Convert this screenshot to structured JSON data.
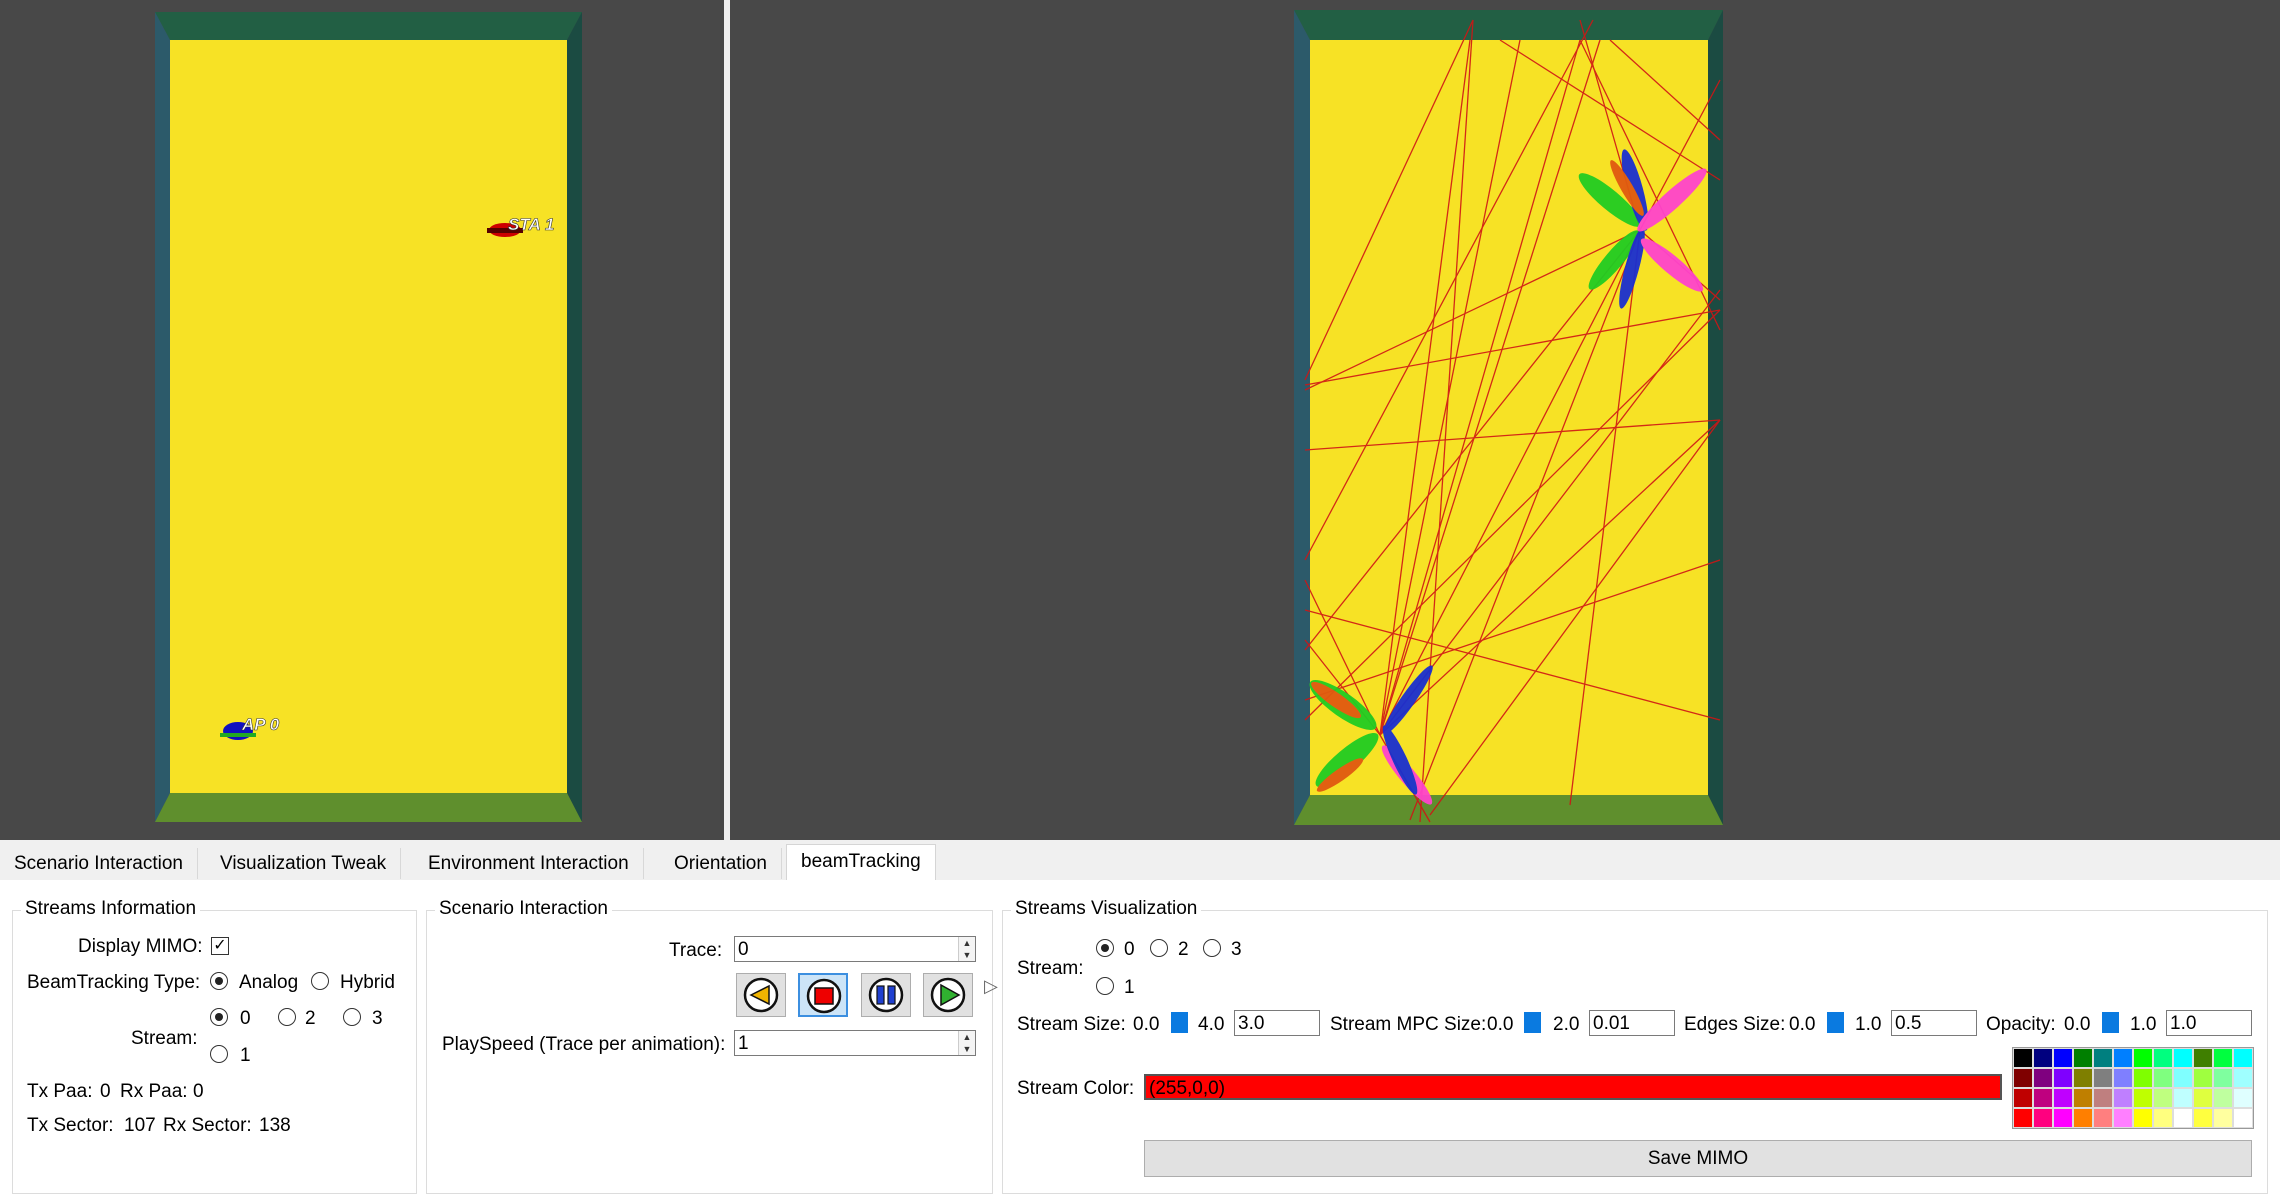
{
  "tabs": [
    {
      "label": "Scenario Interaction"
    },
    {
      "label": "Visualization Tweak"
    },
    {
      "label": "Environment Interaction"
    },
    {
      "label": "Orientation"
    },
    {
      "label": "beamTracking",
      "active": true
    }
  ],
  "left_view": {
    "sta_label": "STA 1",
    "ap_label": "AP 0"
  },
  "streams_info": {
    "title": "Streams Information",
    "display_mimo_label": "Display MIMO:",
    "display_mimo_checked": true,
    "beamtracking_type_label": "BeamTracking Type:",
    "type_options": [
      "Analog",
      "Hybrid"
    ],
    "type_selected": "Analog",
    "stream_label": "Stream:",
    "stream_options": [
      "0",
      "2",
      "3",
      "1"
    ],
    "stream_selected": "0",
    "tx_paa_label": "Tx Paa:",
    "tx_paa_value": "0",
    "rx_paa_label": "Rx Paa:",
    "rx_paa_value": "0",
    "tx_sector_label": "Tx Sector:",
    "tx_sector_value": "107",
    "rx_sector_label": "Rx Sector:",
    "rx_sector_value": "138"
  },
  "scenario_interaction": {
    "title": "Scenario Interaction",
    "trace_label": "Trace:",
    "trace_value": "0",
    "playspeed_label": "PlaySpeed (Trace per animation):",
    "playspeed_value": "1",
    "buttons": [
      "backward-icon",
      "stop-icon",
      "pause-icon",
      "play-icon"
    ]
  },
  "streams_visualization": {
    "title": "Streams Visualization",
    "stream_label": "Stream:",
    "stream_options": [
      "0",
      "2",
      "3",
      "1"
    ],
    "stream_selected": "0",
    "stream_size_label": "Stream Size:",
    "stream_size_min": "0.0",
    "stream_size_max": "4.0",
    "stream_size_value": "3.0",
    "mpc_size_label": "Stream MPC Size:",
    "mpc_size_min": "0.0",
    "mpc_size_max": "2.0",
    "mpc_size_value": "0.01",
    "edges_size_label": "Edges Size:",
    "edges_size_min": "0.0",
    "edges_size_max": "1.0",
    "edges_size_value": "0.5",
    "opacity_label": "Opacity:",
    "opacity_min": "0.0",
    "opacity_max": "1.0",
    "opacity_value": "1.0",
    "stream_color_label": "Stream Color:",
    "stream_color_value": "(255,0,0)",
    "stream_color_hex": "#ff0000",
    "save_label": "Save MIMO"
  },
  "colors": {
    "floor": "#f7e225",
    "wall_top": "#225f44",
    "wall_left": "#2c5a6a",
    "wall_right": "#1b4b42",
    "wall_bottom": "#5f8f2d",
    "background": "#484848",
    "accent": "#0a7ae0"
  }
}
